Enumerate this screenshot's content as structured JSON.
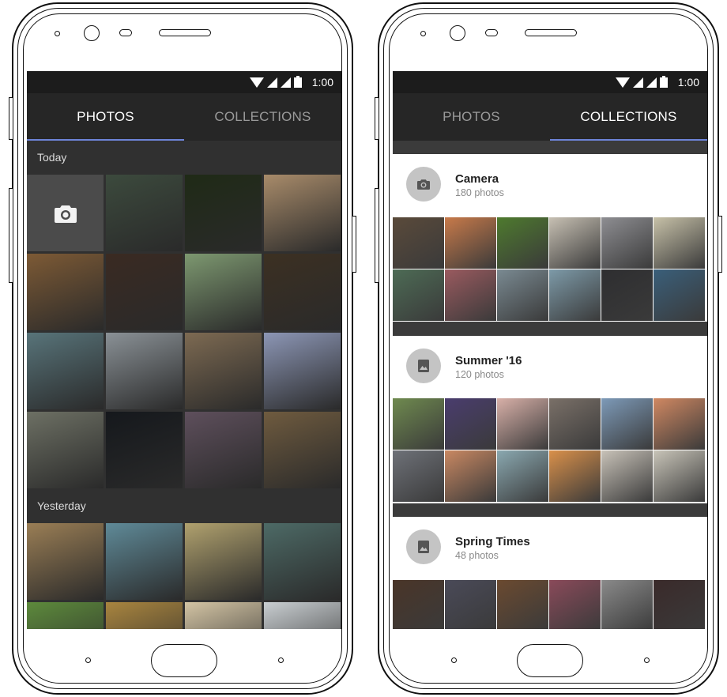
{
  "status_bar": {
    "time": "1:00"
  },
  "tabs": {
    "photos": "PHOTOS",
    "collections": "COLLECTIONS"
  },
  "photos_screen": {
    "sections": [
      {
        "label": "Today"
      },
      {
        "label": "Yesterday"
      }
    ],
    "today_tiles": [
      "#3c4a3d",
      "#1f2a16",
      "#a88b6a",
      "#7d5a35",
      "#3a2a22",
      "#7d9870",
      "#3c3022",
      "#58747a",
      "#8a9196",
      "#7d6a52",
      "#8c96b5",
      "#6d7064",
      "#15181c",
      "#5e4f5c",
      "#6f5b3f"
    ],
    "yesterday_tiles": [
      "#9a7e55",
      "#5f8a98",
      "#b0a16e",
      "#4d6a66",
      "#5d8a3c",
      "#a9853f",
      "#d3c4a4",
      "#c9ced1"
    ]
  },
  "collections_screen": {
    "collections": [
      {
        "name": "Camera",
        "count": "180 photos",
        "icon": "camera-icon",
        "thumbs": [
          "#5a4a3a",
          "#c87a4a",
          "#4e7a2e",
          "#c7c0b3",
          "#8e8e92",
          "#c7c1a8",
          "#4d6b55",
          "#9a5a5f",
          "#7a8a92",
          "#7d9aa8",
          "#2e2e30",
          "#3a5f7a"
        ]
      },
      {
        "name": "Summer '16",
        "count": "120 photos",
        "icon": "image-icon",
        "thumbs": [
          "#6f8a4f",
          "#4a3d6e",
          "#d8b0a8",
          "#7a7068",
          "#7d9ab8",
          "#d08862",
          "#6e7178",
          "#c98862",
          "#8aa8b0",
          "#d9904a",
          "#c8c2b8",
          "#c8c4b8"
        ]
      },
      {
        "name": "Spring Times",
        "count": "48 photos",
        "icon": "image-icon",
        "thumbs": [
          "#4a3528",
          "#4a4a58",
          "#6b4a30",
          "#8a4a5a",
          "#8a8a8a",
          "#3a2a2a"
        ]
      }
    ]
  },
  "colors": {
    "accent": "#6d84d8",
    "tab_bg": "#262626",
    "status_bg": "#1c1c1c"
  }
}
